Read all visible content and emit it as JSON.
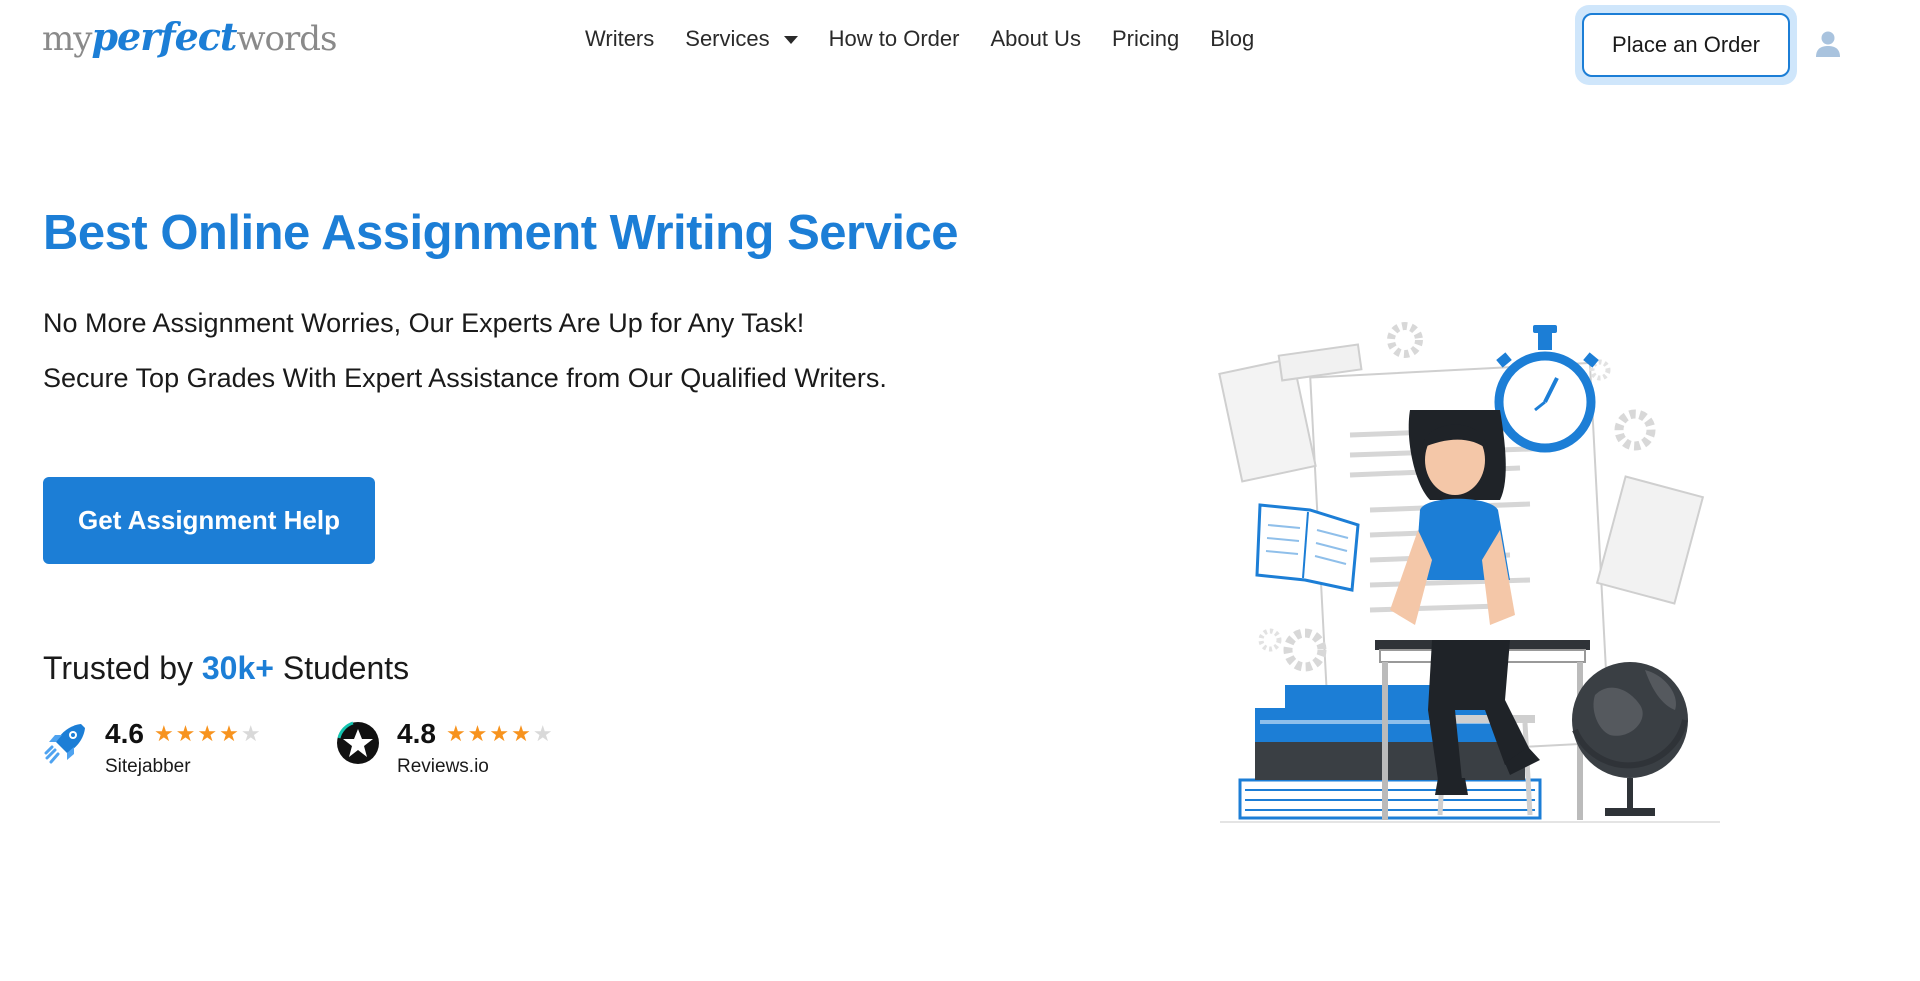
{
  "brand": {
    "part1": "my",
    "part2": "perfect",
    "part3": "words",
    "color": "#1c7ed6"
  },
  "nav": {
    "items": [
      {
        "label": "Writers"
      },
      {
        "label": "Services"
      },
      {
        "label": "How to Order"
      },
      {
        "label": "About Us"
      },
      {
        "label": "Pricing"
      },
      {
        "label": "Blog"
      }
    ],
    "order_button": "Place an Order",
    "user_icon": "user-icon"
  },
  "hero": {
    "title": "Best Online Assignment Writing Service",
    "subtitle_1": "No More Assignment Worries, Our Experts Are Up for Any Task!",
    "subtitle_2": "Secure Top Grades With Expert Assistance from Our Qualified Writers.",
    "cta": "Get Assignment Help"
  },
  "trust": {
    "prefix": "Trusted by",
    "highlight": "30k+",
    "suffix": "Students",
    "ratings": [
      {
        "score": "4.6",
        "source": "Sitejabber",
        "stars": 4.6,
        "icon": "rocket-icon"
      },
      {
        "score": "4.8",
        "source": "Reviews.io",
        "stars": 4.8,
        "icon": "star-badge-icon"
      }
    ]
  },
  "colors": {
    "accent": "#1c7ed6",
    "star": "#f7931e",
    "text": "#1a1a1a"
  }
}
